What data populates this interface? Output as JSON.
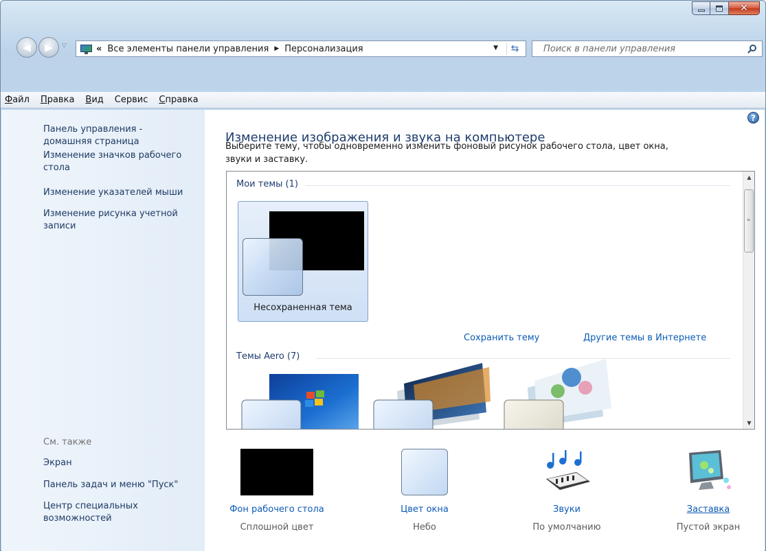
{
  "window": {
    "minimize_icon": "minimize-icon",
    "maximize_icon": "maximize-icon",
    "close_icon": "close-icon"
  },
  "address": {
    "chevrons": "«",
    "crumb1": "Все элементы панели управления",
    "crumb2": "Персонализация",
    "search_placeholder": "Поиск в панели управления"
  },
  "menu": [
    {
      "label": "Файл",
      "u": "Ф",
      "rest": "айл"
    },
    {
      "label": "Правка",
      "u": "П",
      "rest": "равка"
    },
    {
      "label": "Вид",
      "u": "В",
      "rest": "ид"
    },
    {
      "label": "Сервис",
      "u": "",
      "rest": "Сервис"
    },
    {
      "label": "Справка",
      "u": "С",
      "rest": "правка"
    }
  ],
  "sidebar": {
    "home_line1": "Панель управления -",
    "home_line2": "домашняя страница",
    "link1_line1": "Изменение значков рабочего",
    "link1_line2": "стола",
    "link2": "Изменение указателей мыши",
    "link3_line1": "Изменение рисунка учетной",
    "link3_line2": "записи",
    "see_also": "См. также",
    "see_screen": "Экран",
    "see_taskbar": "Панель задач и меню \"Пуск\"",
    "see_access_line1": "Центр специальных",
    "see_access_line2": "возможностей"
  },
  "main": {
    "title": "Изменение изображения и звука на компьютере",
    "desc_line1": "Выберите тему, чтобы одновременно изменить фоновый рисунок рабочего стола, цвет окна,",
    "desc_line2": "звуки и заставку.",
    "my_themes": "Мои темы (1)",
    "unsaved_theme": "Несохраненная тема",
    "save_theme": "Сохранить тему",
    "more_themes": "Другие темы в Интернете",
    "aero_themes": "Темы Aero (7)"
  },
  "bottom": [
    {
      "label": "Фон рабочего стола",
      "sub": "Сплошной цвет"
    },
    {
      "label": "Цвет окна",
      "sub": "Небо"
    },
    {
      "label": "Звуки",
      "sub": "По умолчанию"
    },
    {
      "label": "Заставка",
      "sub": "Пустой экран"
    }
  ],
  "colors": {
    "link": "#0b5bb5",
    "title": "#1e3c6d",
    "sidebar_bg": "#e9f1fa",
    "frame": "#c5d9ec"
  }
}
